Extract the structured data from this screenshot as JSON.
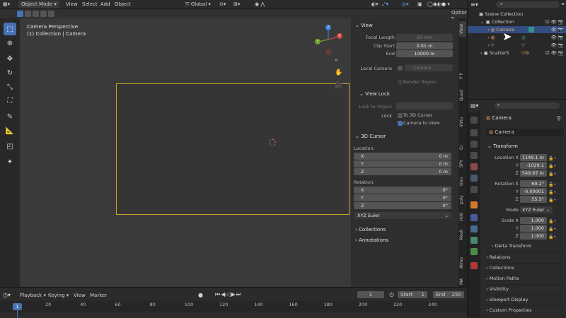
{
  "header": {
    "mode": "Object Mode",
    "menus": [
      "View",
      "Select",
      "Add",
      "Object"
    ],
    "transform_orientation": "Global",
    "options": "Options"
  },
  "viewport": {
    "title": "Camera Perspective",
    "subtitle": "(1) Collection | Camera",
    "gizmo": {
      "x": "X",
      "y": "Y",
      "z": "Z"
    }
  },
  "npanel": {
    "view": {
      "header": "View",
      "focal_label": "Focal Length",
      "focal_value": "50 mm",
      "clip_start_label": "Clip Start",
      "clip_start_value": "0.01 m",
      "end_label": "End",
      "end_value": "10000 m",
      "local_camera_label": "Local Camera",
      "local_camera_value": "Camera",
      "render_region_label": "Render Region"
    },
    "view_lock": {
      "header": "View Lock",
      "lock_object_label": "Lock to Object",
      "lock_label": "Lock",
      "to_cursor_label": "To 3D Cursor",
      "camera_to_view_label": "Camera to View"
    },
    "cursor": {
      "header": "3D Cursor",
      "location_label": "Location:",
      "loc": [
        {
          "axis": "X",
          "value": "0 m"
        },
        {
          "axis": "Y",
          "value": "0 m"
        },
        {
          "axis": "Z",
          "value": "0 m"
        }
      ],
      "rotation_label": "Rotation:",
      "rot": [
        {
          "axis": "X",
          "value": "0°"
        },
        {
          "axis": "Y",
          "value": "0°"
        },
        {
          "axis": "Z",
          "value": "0°"
        }
      ],
      "rotation_mode": "XYZ Euler"
    },
    "collections_header": "Collections",
    "annotations_header": "Annotations"
  },
  "vtabs": [
    "View",
    "Quad",
    "P P",
    "Virtu",
    "Cr",
    "SPY",
    "Geo",
    "poly",
    "Hdri",
    "Mesh",
    "Atmo",
    "MA"
  ],
  "outliner": {
    "scene_collection": "Scene Collection",
    "collection": "Collection",
    "camera": "Camera",
    "scatter": "Scatter5"
  },
  "properties": {
    "object_name": "Camera",
    "object_data_name": "Camera",
    "transform_header": "Transform",
    "location_label": "Location X",
    "location": [
      "1149.1 m",
      "-1029.1",
      "549.67 m"
    ],
    "rotation_label": "Rotation X",
    "rotation": [
      "69.2°",
      "-0.00001",
      "55.5°"
    ],
    "mode_label": "Mode",
    "mode_value": "XYZ Euler",
    "scale_label": "Scale X",
    "scale": [
      "1.000",
      "1.000",
      "1.000"
    ],
    "axis_y": "Y",
    "axis_z": "Z",
    "sections": [
      "Delta Transform",
      "Relations",
      "Collections",
      "Motion Paths",
      "Visibility",
      "Viewport Display",
      "Custom Properties"
    ]
  },
  "timeline": {
    "menus": [
      "Playback",
      "Keying",
      "View",
      "Marker"
    ],
    "current_frame": "1",
    "start_label": "Start",
    "start_value": "1",
    "end_label": "End",
    "end_value": "250",
    "ticks": [
      "20",
      "40",
      "60",
      "80",
      "100",
      "120",
      "140",
      "160",
      "180",
      "200",
      "220",
      "240"
    ],
    "playhead": "1"
  },
  "colors": {
    "accent": "#4772b3",
    "camera_frame": "#c9a227",
    "x_axis": "#d4453c",
    "y_axis": "#6ba02b",
    "z_axis": "#3b7fd4"
  }
}
